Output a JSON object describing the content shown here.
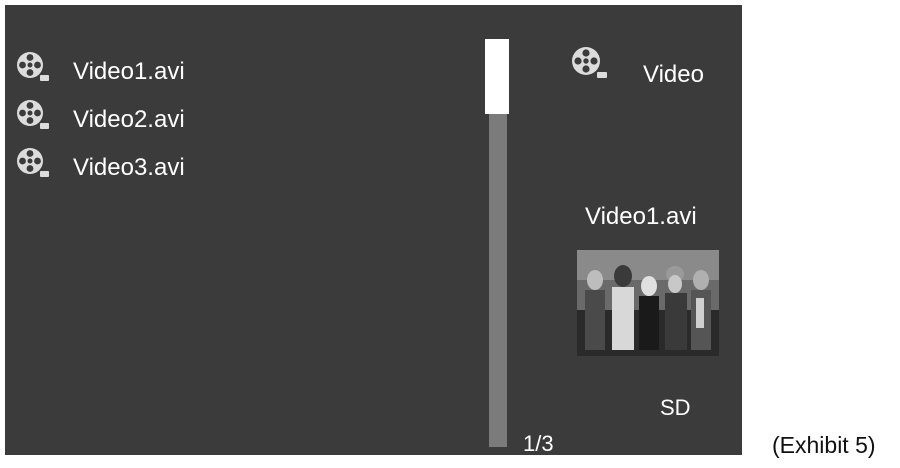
{
  "file_list": {
    "items": [
      {
        "name": "Video1.avi",
        "icon": "film-reel-icon"
      },
      {
        "name": "Video2.avi",
        "icon": "film-reel-icon"
      },
      {
        "name": "Video3.avi",
        "icon": "film-reel-icon"
      }
    ]
  },
  "scrollbar": {
    "page_indicator": "1/3"
  },
  "info_panel": {
    "type_label": "Video",
    "type_icon": "film-reel-icon",
    "selected_file": "Video1.avi",
    "quality": "SD",
    "thumbnail": "video-thumbnail-image"
  },
  "caption": "(Exhibit 5)",
  "colors": {
    "screen_background": "#3b3b3b",
    "scroll_track": "#7b7b7b",
    "scroll_thumb": "#ffffff",
    "text": "#ffffff"
  }
}
